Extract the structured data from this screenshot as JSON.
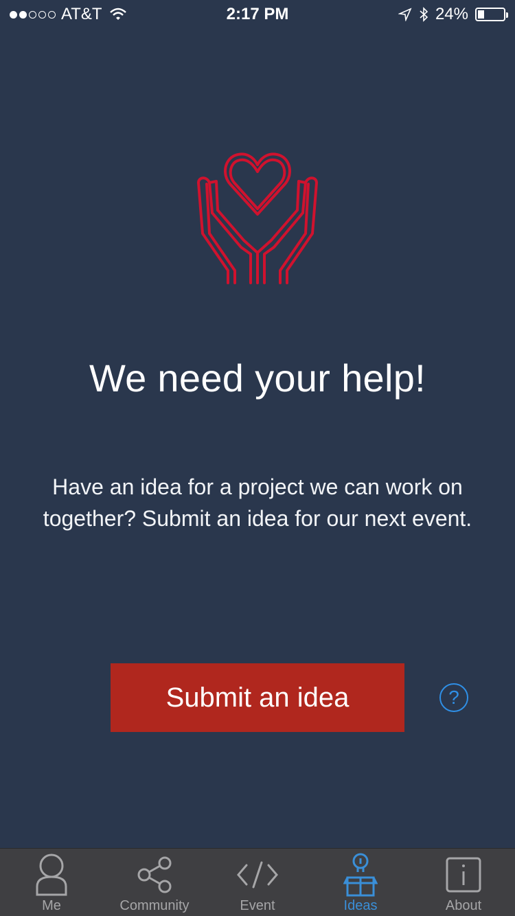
{
  "status_bar": {
    "carrier": "AT&T",
    "time": "2:17 PM",
    "battery_percent": "24%",
    "battery_level": 0.24,
    "signal_bars_filled": 2,
    "signal_bars_total": 5
  },
  "main": {
    "hero_icon": "hands-holding-heart-icon",
    "headline": "We need your help!",
    "description": "Have an idea for a project we can work on together?  Submit an idea for our next event.",
    "submit_label": "Submit an idea",
    "help_label": "?"
  },
  "tabbar": {
    "active": "Ideas",
    "tabs": [
      {
        "label": "Me",
        "icon": "person-icon"
      },
      {
        "label": "Community",
        "icon": "share-icon"
      },
      {
        "label": "Event",
        "icon": "code-icon"
      },
      {
        "label": "Ideas",
        "icon": "lightbulb-box-icon"
      },
      {
        "label": "About",
        "icon": "info-icon"
      }
    ]
  },
  "colors": {
    "background": "#2a374d",
    "accent_red": "#b0271e",
    "icon_red": "#d0122e",
    "tab_active": "#3a8fd8",
    "tab_inactive": "#a6a6a8",
    "tabbar_bg": "#3f3f42"
  }
}
